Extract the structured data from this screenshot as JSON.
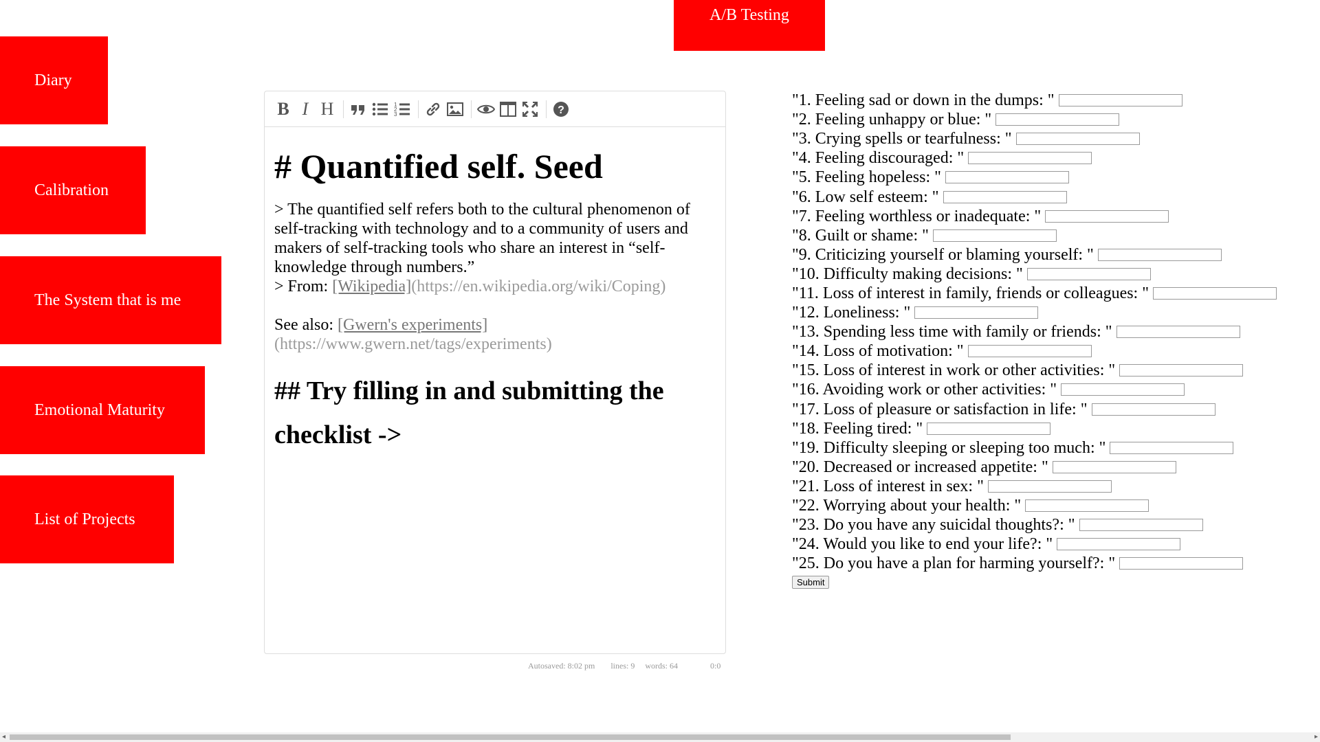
{
  "top_button": {
    "label": "A/B Testing"
  },
  "nav": [
    {
      "label": "Diary"
    },
    {
      "label": "Calibration"
    },
    {
      "label": "The System that is me"
    },
    {
      "label": "Emotional Maturity"
    },
    {
      "label": "List of Projects"
    }
  ],
  "editor": {
    "toolbar_icons": [
      "bold-icon",
      "italic-icon",
      "heading-icon",
      "quote-icon",
      "unordered-list-icon",
      "ordered-list-icon",
      "link-icon",
      "image-icon",
      "preview-icon",
      "side-by-side-icon",
      "fullscreen-icon",
      "help-icon"
    ],
    "h1": "# Quantified self. Seed",
    "quote": "> The quantified self refers both to the cultural phenomenon of self-tracking with technology and to a community of users and makers of self-tracking tools who share an interest in “self-knowledge through numbers.”",
    "from_prefix": "> From: ",
    "from_link": "[Wikipedia]",
    "from_url": "(https://en.wikipedia.org/wiki/Coping)",
    "see_also_prefix": "See also: ",
    "see_also_link": "[Gwern's experiments]",
    "see_also_url": "(https://www.gwern.net/tags/experiments)",
    "h2": "## Try filling in and submitting the checklist ->"
  },
  "statusbar": {
    "autosave": "Autosaved: 8:02 pm",
    "lines": "lines: 9",
    "words": "words: 64",
    "cursor": "0:0"
  },
  "checklist": {
    "questions": [
      "\"1. Feeling sad or down in the dumps: \"",
      "\"2. Feeling unhappy or blue: \"",
      "\"3. Crying spells or tearfulness: \"",
      "\"4. Feeling discouraged: \"",
      "\"5. Feeling hopeless: \"",
      "\"6. Low self esteem: \"",
      "\"7. Feeling worthless or inadequate: \"",
      "\"8. Guilt or shame: \"",
      "\"9. Criticizing yourself or blaming yourself: \"",
      "\"10. Difficulty making decisions: \"",
      "\"11. Loss of interest in family, friends or colleagues: \"",
      "\"12. Loneliness: \"",
      "\"13. Spending less time with family or friends: \"",
      "\"14. Loss of motivation: \"",
      "\"15. Loss of interest in work or other activities: \"",
      "\"16. Avoiding work or other activities: \"",
      "\"17. Loss of pleasure or satisfaction in life: \"",
      "\"18. Feeling tired: \"",
      "\"19. Difficulty sleeping or sleeping too much: \"",
      "\"20. Decreased or increased appetite: \"",
      "\"21. Loss of interest in sex: \"",
      "\"22. Worrying about your health: \"",
      "\"23. Do you have any suicidal thoughts?: \"",
      "\"24. Would you like to end your life?: \"",
      "\"25. Do you have a plan for harming yourself?: \""
    ],
    "submit_label": "Submit"
  },
  "colors": {
    "nav_bg": "#ff0000",
    "nav_text": "#ffffff"
  }
}
